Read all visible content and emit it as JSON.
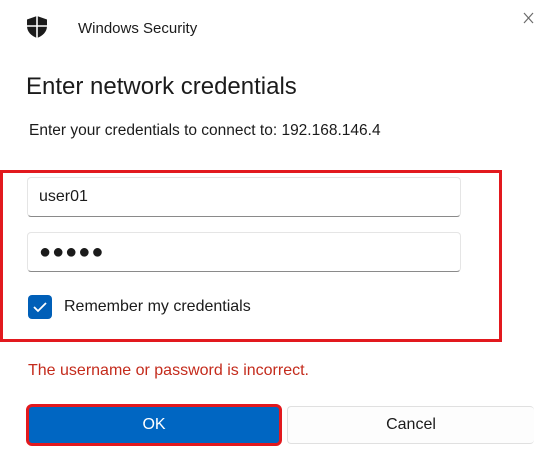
{
  "window": {
    "app_title": "Windows Security",
    "app_icon": "shield-icon",
    "close_icon": "close-icon"
  },
  "dialog": {
    "heading": "Enter network credentials",
    "subtitle": "Enter your credentials to connect to: 192.168.146.4"
  },
  "form": {
    "username_value": "user01",
    "password_display": "●●●●●",
    "remember_checked": true,
    "remember_label": "Remember my credentials"
  },
  "error": {
    "message": "The username or password is incorrect."
  },
  "buttons": {
    "ok_label": "OK",
    "cancel_label": "Cancel"
  },
  "colors": {
    "accent": "#0066c2",
    "error": "#c42b1c",
    "highlight_box": "#e2191e"
  }
}
